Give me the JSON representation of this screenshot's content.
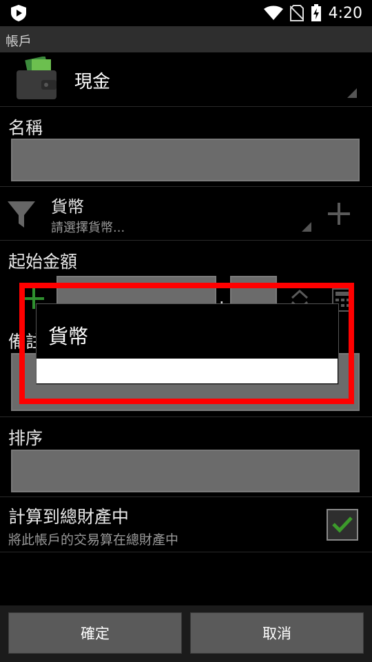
{
  "status_bar": {
    "time": "4:20",
    "icons": [
      "app-shield-icon",
      "wifi-icon",
      "no-sim-icon",
      "battery-charging-icon"
    ]
  },
  "title_bar": {
    "title": "帳戶"
  },
  "account": {
    "name": "現金",
    "icon": "wallet-icon"
  },
  "name_section": {
    "label": "名稱",
    "value": ""
  },
  "currency_section": {
    "title": "貨幣",
    "subtitle": "請選擇貨幣...",
    "filter_icon": "filter-icon",
    "add_icon": "plus-icon"
  },
  "starting_amount": {
    "label": "起始金額",
    "sign_icon": "plus-icon",
    "integer_value": "",
    "decimal_separator": ".",
    "decimal_value": ""
  },
  "note_section": {
    "label": "備註",
    "value": ""
  },
  "sort_section": {
    "label": "排序",
    "value": ""
  },
  "include_total": {
    "title": "計算到總財產中",
    "subtitle": "將此帳戶的交易算在總財產中",
    "checked": true
  },
  "buttons": {
    "confirm": "確定",
    "cancel": "取消"
  },
  "dialog": {
    "title": "貨幣",
    "items": []
  },
  "colors": {
    "highlight": "#ff0000",
    "check": "#3c9a2b",
    "field": "#6b6b6b"
  }
}
